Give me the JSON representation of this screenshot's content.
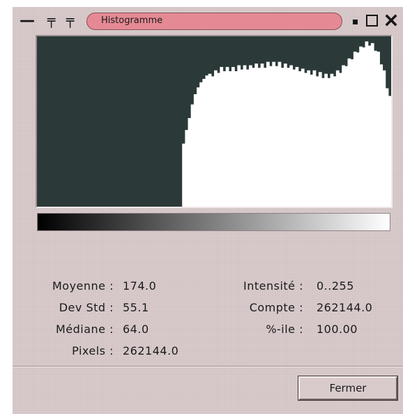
{
  "window": {
    "title": "Histogramme",
    "icons": [
      "minimize-dash-icon",
      "pin-icon",
      "pin-top-icon",
      "iconify-icon",
      "maximize-icon",
      "close-icon"
    ]
  },
  "histogram": {
    "type": "area",
    "bin_range": [
      0,
      255
    ],
    "background_color": "#2b3a38",
    "fill_color": "#ffffff",
    "gradient": [
      "#000000",
      "#ffffff"
    ],
    "relative_heights": [
      0,
      0,
      0,
      0,
      0,
      0,
      0,
      0,
      0,
      0,
      0,
      0,
      0,
      0,
      0,
      0,
      0,
      0,
      0,
      0,
      0,
      0,
      0,
      0,
      0,
      0,
      0,
      0,
      0,
      0,
      0,
      0,
      0,
      0,
      0,
      0,
      0,
      0,
      0,
      0,
      0,
      0,
      0,
      0,
      0,
      0,
      0,
      0,
      0,
      0,
      0.37,
      0.45,
      0.52,
      0.6,
      0.66,
      0.7,
      0.73,
      0.75,
      0.77,
      0.78,
      0.79,
      0.8,
      0.81,
      0.82,
      0.82,
      0.82,
      0.82,
      0.82,
      0.82,
      0.83,
      0.83,
      0.83,
      0.83,
      0.83,
      0.84,
      0.84,
      0.84,
      0.84,
      0.84,
      0.85,
      0.85,
      0.85,
      0.85,
      0.85,
      0.84,
      0.84,
      0.84,
      0.83,
      0.83,
      0.82,
      0.82,
      0.81,
      0.81,
      0.8,
      0.8,
      0.8,
      0.79,
      0.79,
      0.78,
      0.78,
      0.78,
      0.78,
      0.79,
      0.8,
      0.81,
      0.83,
      0.85,
      0.87,
      0.89,
      0.91,
      0.93,
      0.94,
      0.96,
      0.97,
      0.97,
      0.96,
      0.94,
      0.91,
      0.86,
      0.8,
      0.72,
      0.65
    ]
  },
  "stats": {
    "moyenne_label": "Moyenne :",
    "moyenne_value": "174.0",
    "devstd_label": "Dev Std :",
    "devstd_value": "55.1",
    "mediane_label": "Médiane :",
    "mediane_value": "64.0",
    "pixels_label": "Pixels :",
    "pixels_value": "262144.0",
    "intensite_label": "Intensité :",
    "intensite_value": "0..255",
    "compte_label": "Compte :",
    "compte_value": "262144.0",
    "pctile_label": "%-ile :",
    "pctile_value": "100.00"
  },
  "buttons": {
    "close_label": "Fermer"
  }
}
